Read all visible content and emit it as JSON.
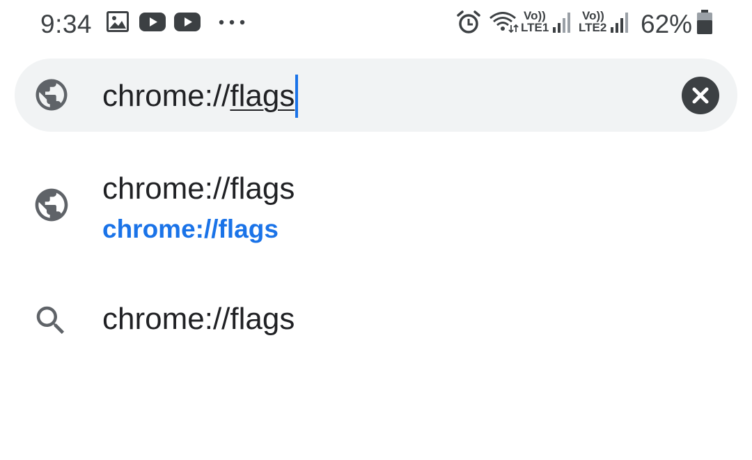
{
  "status_bar": {
    "time": "9:34",
    "battery_percent": "62%",
    "sim1_volte": "Vo))",
    "sim1_lte": "LTE1",
    "sim2_volte": "Vo))",
    "sim2_lte": "LTE2",
    "notification_icons": [
      "gallery-icon",
      "youtube-icon",
      "youtube-icon",
      "more-dots-icon"
    ],
    "system_icons": [
      "alarm-icon",
      "wifi-icon",
      "signal-icon",
      "signal-icon",
      "battery-icon"
    ]
  },
  "omnibox": {
    "typed_text": "chrome://",
    "autocomplete_text": "flags",
    "icon": "globe-icon",
    "clear_icon": "close-icon"
  },
  "suggestions": [
    {
      "icon": "globe-icon",
      "title": "chrome://flags",
      "url": "chrome://flags"
    },
    {
      "icon": "search-icon",
      "title": "chrome://flags"
    }
  ],
  "colors": {
    "accent": "#1a73e8",
    "omnibox_bg": "#f1f3f4",
    "icon_gray": "#5f6368",
    "text": "#202124"
  }
}
